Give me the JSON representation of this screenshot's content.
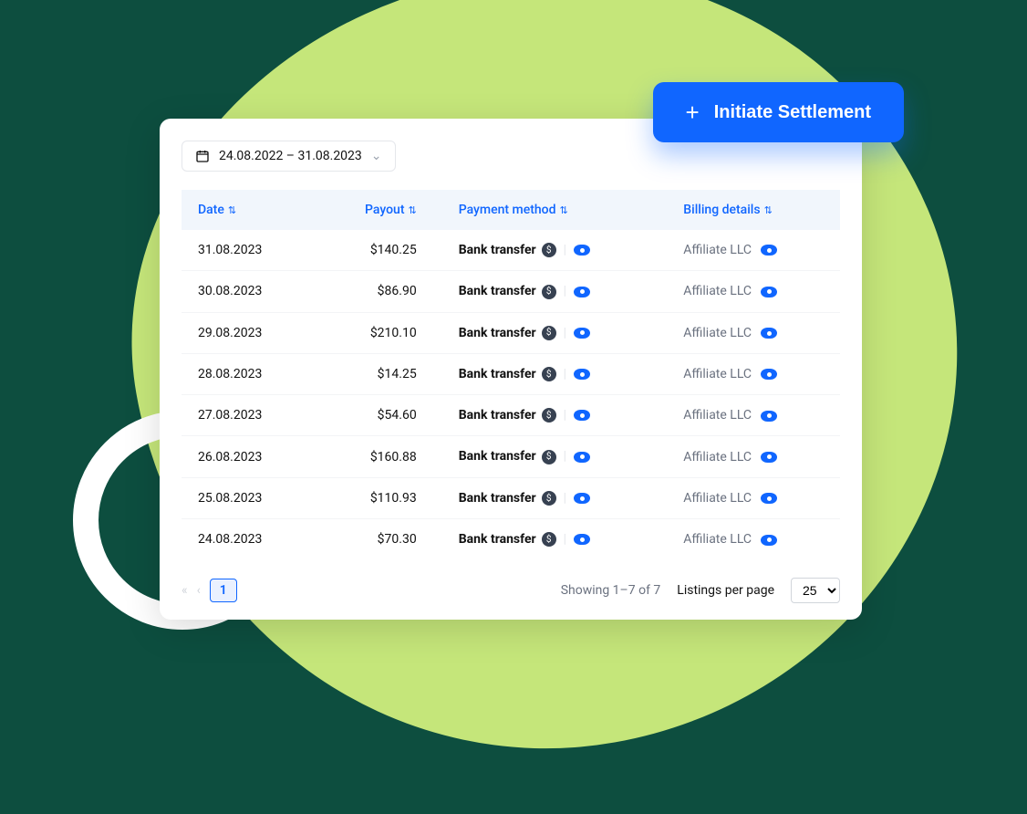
{
  "cta_label": "Initiate Settlement",
  "date_range": "24.08.2022 – 31.08.2023",
  "columns": {
    "date": "Date",
    "payout": "Payout",
    "payment_method": "Payment method",
    "billing_details": "Billing details"
  },
  "rows": [
    {
      "date": "31.08.2023",
      "payout": "$140.25",
      "method": "Bank transfer",
      "billing": "Affiliate LLC"
    },
    {
      "date": "30.08.2023",
      "payout": "$86.90",
      "method": "Bank transfer",
      "billing": "Affiliate LLC"
    },
    {
      "date": "29.08.2023",
      "payout": "$210.10",
      "method": "Bank transfer",
      "billing": "Affiliate LLC"
    },
    {
      "date": "28.08.2023",
      "payout": "$14.25",
      "method": "Bank transfer",
      "billing": "Affiliate LLC"
    },
    {
      "date": "27.08.2023",
      "payout": "$54.60",
      "method": "Bank transfer",
      "billing": "Affiliate LLC"
    },
    {
      "date": "26.08.2023",
      "payout": "$160.88",
      "method": "Bank transfer",
      "billing": "Affiliate LLC"
    },
    {
      "date": "25.08.2023",
      "payout": "$110.93",
      "method": "Bank transfer",
      "billing": "Affiliate LLC"
    },
    {
      "date": "24.08.2023",
      "payout": "$70.30",
      "method": "Bank transfer",
      "billing": "Affiliate LLC"
    }
  ],
  "pagination": {
    "current_page": "1",
    "showing": "Showing 1–7 of 7",
    "per_page_label": "Listings per page",
    "per_page_value": "25"
  }
}
